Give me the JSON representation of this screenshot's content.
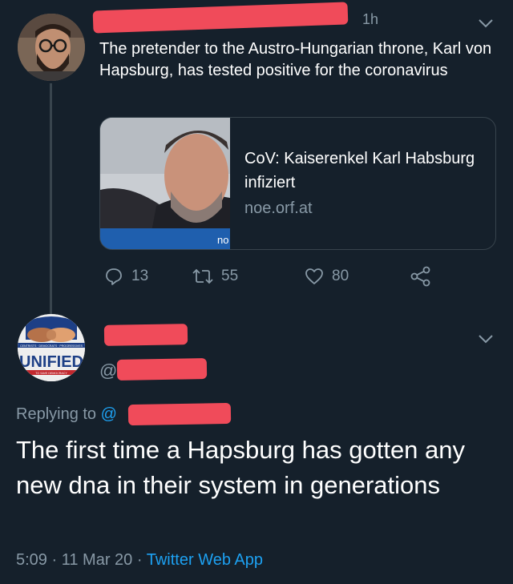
{
  "tweet1": {
    "time": "1h",
    "text": "The pretender to the Austro-Hungarian throne, Karl von Hapsburg, has tested positive for the coronavirus",
    "card": {
      "title": "CoV: Kaiserenkel Karl Habsburg infiziert",
      "domain": "noe.orf.at",
      "image_caption": "no"
    },
    "actions": {
      "replies": "13",
      "retweets": "55",
      "likes": "80"
    }
  },
  "tweet2": {
    "avatar_logo": {
      "top_text": "CENTRISTS · DEMOCRATS · PROGRESSIVES",
      "main_text": "UNIFIED",
      "bottom_text": "TO SAVE DEMOCRACY"
    },
    "handle_prefix": "@",
    "replying_to_label": "Replying to",
    "replying_to_mention": "@",
    "text": "The first time a Hapsburg has gotten any new dna in their system in generations",
    "time": "5:09",
    "date": "11 Mar 20",
    "separator": "·",
    "app": "Twitter Web App"
  },
  "icons": {
    "reply": "reply-icon",
    "retweet": "retweet-icon",
    "like": "heart-icon",
    "share": "share-icon",
    "menu": "chevron-down-icon"
  },
  "colors": {
    "background": "#15202b",
    "secondary_text": "#8899a6",
    "link": "#1da1f2",
    "border": "#38444d",
    "redaction": "#f04b5a"
  }
}
